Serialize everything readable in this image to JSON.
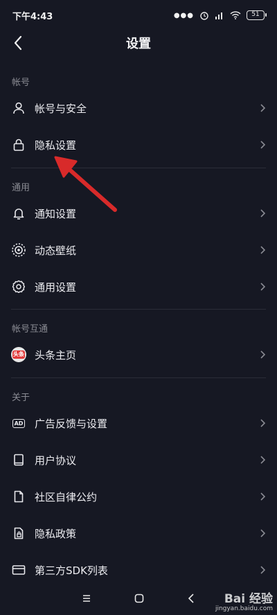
{
  "status_bar": {
    "time": "下午4:43",
    "battery": "51"
  },
  "header": {
    "title": "设置"
  },
  "sections": [
    {
      "label": "帐号",
      "items": [
        {
          "label": "帐号与安全",
          "icon": "user-icon"
        },
        {
          "label": "隐私设置",
          "icon": "lock-icon"
        }
      ]
    },
    {
      "label": "通用",
      "items": [
        {
          "label": "通知设置",
          "icon": "bell-icon"
        },
        {
          "label": "动态壁纸",
          "icon": "wallpaper-icon"
        },
        {
          "label": "通用设置",
          "icon": "gear-icon"
        }
      ]
    },
    {
      "label": "帐号互通",
      "items": [
        {
          "label": "头条主页",
          "icon": "toutiao-logo-icon",
          "badge_text": "头条"
        }
      ]
    },
    {
      "label": "关于",
      "items": [
        {
          "label": "广告反馈与设置",
          "icon": "ad-icon",
          "icon_text": "AD"
        },
        {
          "label": "用户协议",
          "icon": "book-icon"
        },
        {
          "label": "社区自律公约",
          "icon": "document-icon"
        },
        {
          "label": "隐私政策",
          "icon": "privacy-document-icon"
        },
        {
          "label": "第三方SDK列表",
          "icon": "sdk-list-icon"
        }
      ]
    }
  ],
  "annotation": {
    "type": "red-arrow",
    "points_to": "隐私设置",
    "color": "#d82a2a"
  },
  "watermark": {
    "text": "Bai 经验",
    "url": "jingyan.baidu.com"
  },
  "colors": {
    "background": "#161823",
    "text": "#ececf0",
    "muted": "#8a8b93",
    "divider": "#2b2d38"
  }
}
